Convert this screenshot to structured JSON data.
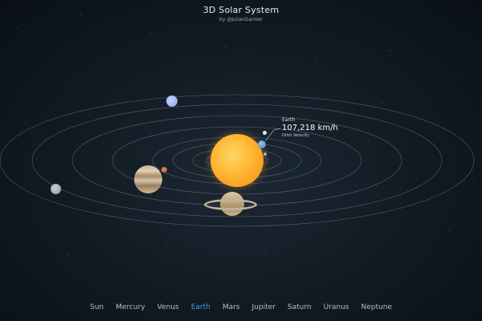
{
  "header": {
    "title": "3D Solar System",
    "byline": "by @JulianGarnier"
  },
  "info_card": {
    "planet_name": "Earth",
    "value": "107,218 km/h",
    "label": "Orbit Velocity"
  },
  "nav": {
    "selected": "Earth",
    "accent_color": "#35a7e0",
    "items": [
      {
        "label": "Sun"
      },
      {
        "label": "Mercury"
      },
      {
        "label": "Venus"
      },
      {
        "label": "Earth"
      },
      {
        "label": "Mars"
      },
      {
        "label": "Jupiter"
      },
      {
        "label": "Saturn"
      },
      {
        "label": "Uranus"
      },
      {
        "label": "Neptune"
      }
    ]
  },
  "colors": {
    "background": "#121c25",
    "sun": "#ffb531",
    "orbit": "#8c9aa6"
  }
}
